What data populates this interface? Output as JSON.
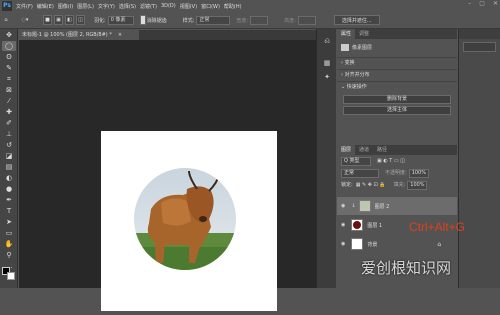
{
  "menubar": {
    "items": [
      "文件(F)",
      "编辑(E)",
      "图像(I)",
      "图层(L)",
      "文字(Y)",
      "选择(S)",
      "滤镜(T)",
      "3D(D)",
      "视图(V)",
      "窗口(W)",
      "帮助(H)"
    ],
    "logo": "Ps"
  },
  "options": {
    "feather_label": "羽化:",
    "feather_value": "0 像素",
    "antialias": "消除锯齿",
    "style_label": "样式:",
    "style_value": "正常",
    "width_label": "宽度:",
    "height_label": "高度:",
    "select_mask": "选择并遮住..."
  },
  "document": {
    "tab_title": "未标题-1 @ 100% (图层 2, RGB/8#) *"
  },
  "properties": {
    "tab1": "属性",
    "tab2": "调整",
    "title": "像素图层",
    "transform": "变换",
    "align": "对齐并分布",
    "quick_actions": "快速操作",
    "remove_bg": "删除背景",
    "select_subject": "选择主体"
  },
  "layers": {
    "tab1": "图层",
    "tab2": "通道",
    "tab3": "路径",
    "kind_label": "Q 类型",
    "blend": "正常",
    "opacity_label": "不透明度:",
    "opacity": "100%",
    "lock_label": "锁定:",
    "fill_label": "填充:",
    "fill": "100%",
    "items": [
      {
        "name": "图层 2"
      },
      {
        "name": "图层 1"
      },
      {
        "name": "背景"
      }
    ]
  },
  "hint": "Ctrl+Alt+G",
  "watermark": "爱创根知识网"
}
